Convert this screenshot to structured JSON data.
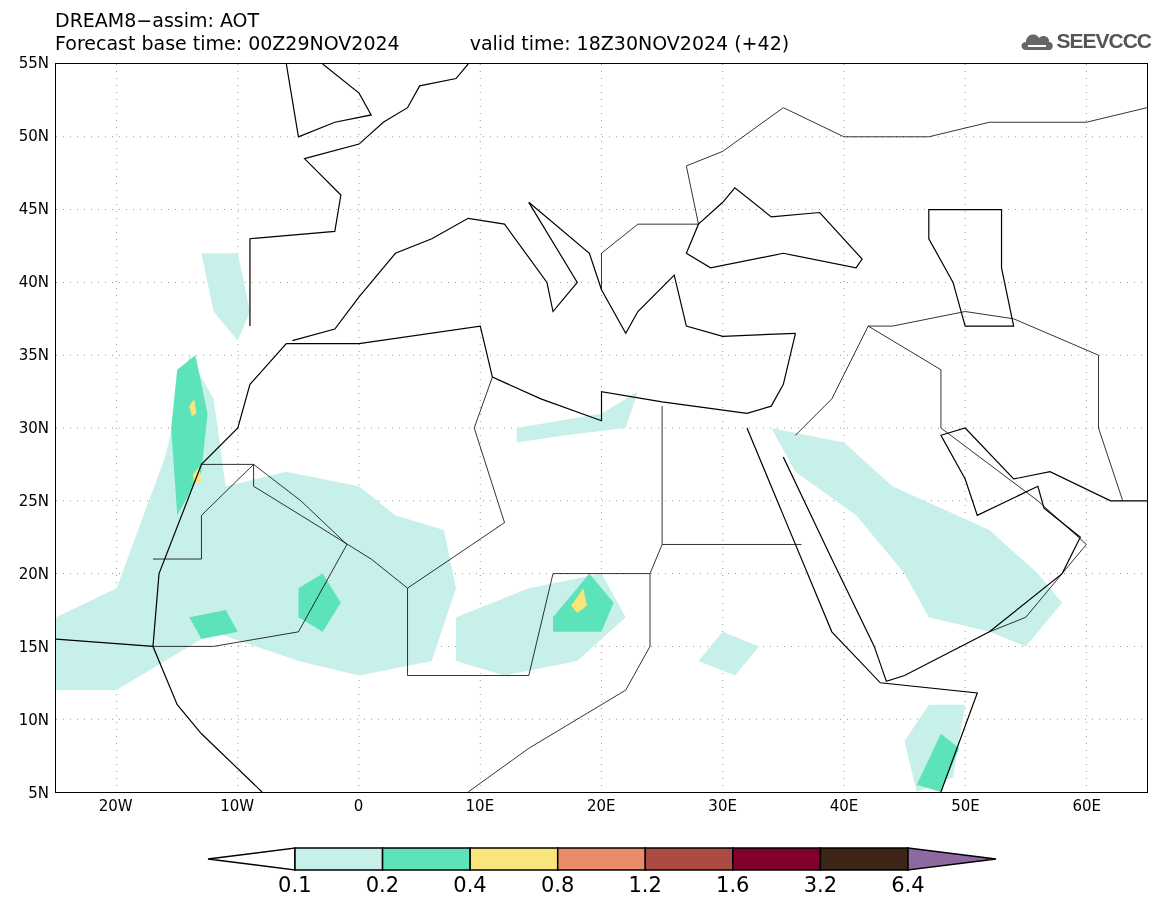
{
  "header": {
    "title": "DREAM8−assim: AOT",
    "base_time": "Forecast base time: 00Z29NOV2024",
    "valid_time": "valid time: 18Z30NOV2024 (+42)",
    "logo": "SEEVCCC"
  },
  "map": {
    "y_labels": [
      "55N",
      "50N",
      "45N",
      "40N",
      "35N",
      "30N",
      "25N",
      "20N",
      "15N",
      "10N",
      "5N"
    ],
    "x_labels": [
      "20W",
      "10W",
      "0",
      "10E",
      "20E",
      "30E",
      "40E",
      "50E",
      "60E"
    ]
  },
  "colorbar": {
    "bins": [
      {
        "kind": "under",
        "color": "#ffffff"
      },
      {
        "kind": "bin",
        "color": "#c8f0ea"
      },
      {
        "kind": "bin",
        "color": "#5de3b9"
      },
      {
        "kind": "bin",
        "color": "#f8e67c"
      },
      {
        "kind": "bin",
        "color": "#ea8b6a"
      },
      {
        "kind": "bin",
        "color": "#ac4a43"
      },
      {
        "kind": "bin",
        "color": "#82002c"
      },
      {
        "kind": "bin",
        "color": "#3e2616"
      },
      {
        "kind": "over",
        "color": "#8e68a0"
      }
    ],
    "labels": [
      "0.1",
      "0.2",
      "0.4",
      "0.8",
      "1.2",
      "1.6",
      "3.2",
      "6.4"
    ]
  }
}
